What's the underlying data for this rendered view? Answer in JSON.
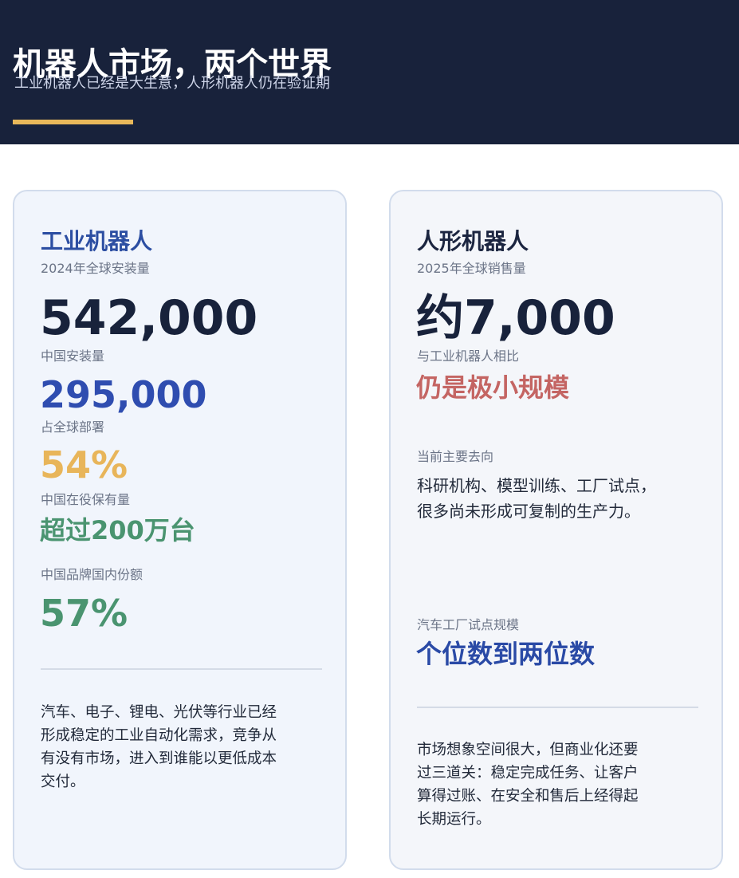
{
  "header": {
    "title": "机器人市场，两个世界",
    "subtitle": "工业机器人已经是大生意，人形机器人仍在验证期",
    "accent_color": "#e8b85a",
    "background_color": "#18223b"
  },
  "industrial": {
    "heading": "工业机器人",
    "global_install_label": "2024年全球安装量",
    "global_install_value": "542,000",
    "china_install_label": "中国安装量",
    "china_install_value": "295,000",
    "share_label": "占全球部署",
    "share_value": "54%",
    "stock_label": "中国在役保有量",
    "stock_value": "超过200万台",
    "brand_share_label": "中国品牌国内份额",
    "brand_share_value": "57%",
    "description": "汽车、电子、锂电、光伏等行业已经\n形成稳定的工业自动化需求，竞争从\n有没有市场，进入到谁能以更低成本\n交付。"
  },
  "humanoid": {
    "heading": "人形机器人",
    "sales_label": "2025年全球销售量",
    "sales_value": "约7,000",
    "compare_label": "与工业机器人相比",
    "compare_value": "仍是极小规模",
    "direction_label": "当前主要去向",
    "direction_text": "科研机构、模型训练、工厂试点，\n很多尚未形成可复制的生产力。",
    "pilot_label": "汽车工厂试点规模",
    "pilot_value": "个位数到两位数",
    "description": "市场想象空间很大，但商业化还要\n过三道关：稳定完成任务、让客户\n算得过账、在安全和售后上经得起\n长期运行。"
  }
}
